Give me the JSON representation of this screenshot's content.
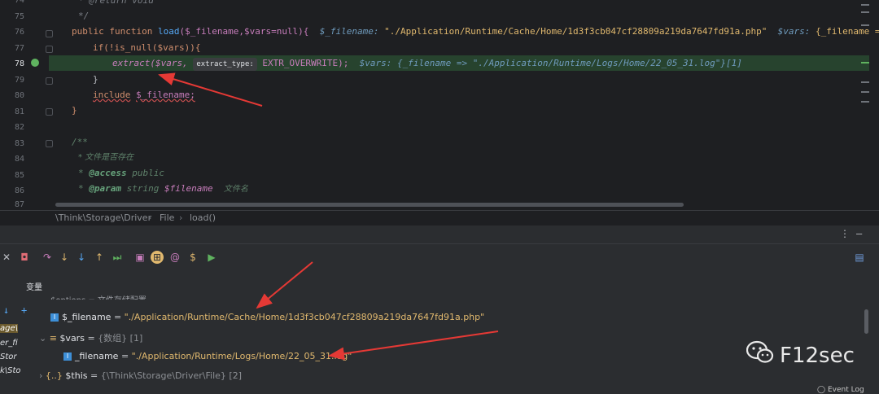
{
  "editor": {
    "lines": [
      {
        "num": "74",
        "text": "* @return void"
      },
      {
        "num": "75",
        "text": "*/"
      },
      {
        "num": "76",
        "kw1": "public",
        "kw2": "function",
        "fn": "load",
        "args": "($_filename,$vars=null){",
        "inline1_name": "$_filename:",
        "inline1_val": "\"./Application/Runtime/Cache/Home/1d3f3cb047cf28809a219da7647fd91a.php\"",
        "inline2_name": "$vars:",
        "inline2_val": "{_filename => \"./Applica"
      },
      {
        "num": "77",
        "text": "if(!is_null($vars)){"
      },
      {
        "num": "78",
        "call": "extract($vars,",
        "hint": "extract_type:",
        "rest": "EXTR_OVERWRITE);",
        "inline_name": "$vars:",
        "inline_val": "{_filename => \"./Application/Runtime/Logs/Home/22_05_31.log\"}[1]"
      },
      {
        "num": "79",
        "text": "}"
      },
      {
        "num": "80",
        "kw": "include",
        "var": "$_filename;"
      },
      {
        "num": "81",
        "text": "}"
      },
      {
        "num": "82",
        "text": ""
      },
      {
        "num": "83",
        "text": "/**"
      },
      {
        "num": "84",
        "text": "* 文件是否存在"
      },
      {
        "num": "85",
        "tag": "@access",
        "rest": "public"
      },
      {
        "num": "86",
        "tag": "@param",
        "rest": "string",
        "pvar": "$filename",
        "desc": "文件名"
      },
      {
        "num": "87",
        "text": ""
      }
    ]
  },
  "breadcrumb": [
    "\\Think\\Storage\\Driver",
    "File",
    "load()"
  ],
  "variables": {
    "title": "变量",
    "options_row": "$options = 文件存储配置",
    "filename_name": "$_filename",
    "filename_val": "\"./Application/Runtime/Cache/Home/1d3f3cb047cf28809a219da7647fd91a.php\"",
    "vars_name": "$vars",
    "vars_val": "{数组} [1]",
    "sub_name": "_filename",
    "sub_val": "\"./Application/Runtime/Logs/Home/22_05_31.log\"",
    "this_name": "$this",
    "this_val": "{\\Think\\Storage\\Driver\\File} [2]"
  },
  "sidebar": {
    "frag1": "age\\",
    "frag2": "er_fi",
    "frag3": "Stor",
    "frag4": "k\\Sto"
  },
  "watermark": "F12sec",
  "event_log": "Event Log",
  "colors": {
    "accent": "#56a8f5",
    "highlight": "#27432e",
    "arrow": "#e53935"
  }
}
